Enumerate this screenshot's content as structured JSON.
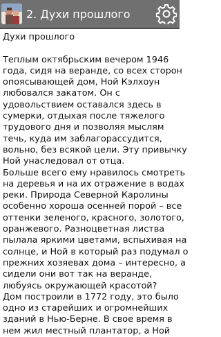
{
  "action_bar": {
    "title": "2. Духи прошлого",
    "settings_icon": "gear-icon",
    "app_icon": "book-icon",
    "background_color": "#707070",
    "title_color": "#ffffff"
  },
  "content": {
    "heading": "Духи прошлого",
    "lines": [
      "Теплым октябрьским вечером 1946",
      "года, сидя на веранде, со всех сторон",
      "опоясывающей дом, Ной Кэлхоун",
      "любовался закатом. Он с",
      "удовольствием оставался здесь в",
      "сумерки, отдыхая после тяжелого",
      "трудового дня и позволяя мыслям",
      "течь, куда им заблагорассудится,",
      "вольно, без всякой цели. Эту привычку",
      "Ной унаследовал от отца.",
      "Больше всего ему нравилось смотреть",
      "на деревья и на их отражение в водах",
      "реки. Природа Северной Каролины",
      "особенно хороша осенней порой – все",
      "оттенки зеленого, красного, золотого,",
      "оранжевого. Разноцветная листва",
      "пылала яркими цветами, вспыхивая на",
      "солнце, и Ной в который раз подумал о",
      "прежних хозяевах дома – интересно, а",
      "сидели они вот так на веранде,",
      "любуясь окружающей красотой?",
      "Дом построили в 1772 году, это было",
      "одно из старейших и огромнейших",
      "зданий в Нью-Берне. В свое время в",
      "нем жил местный плантатор, а Ной"
    ]
  }
}
